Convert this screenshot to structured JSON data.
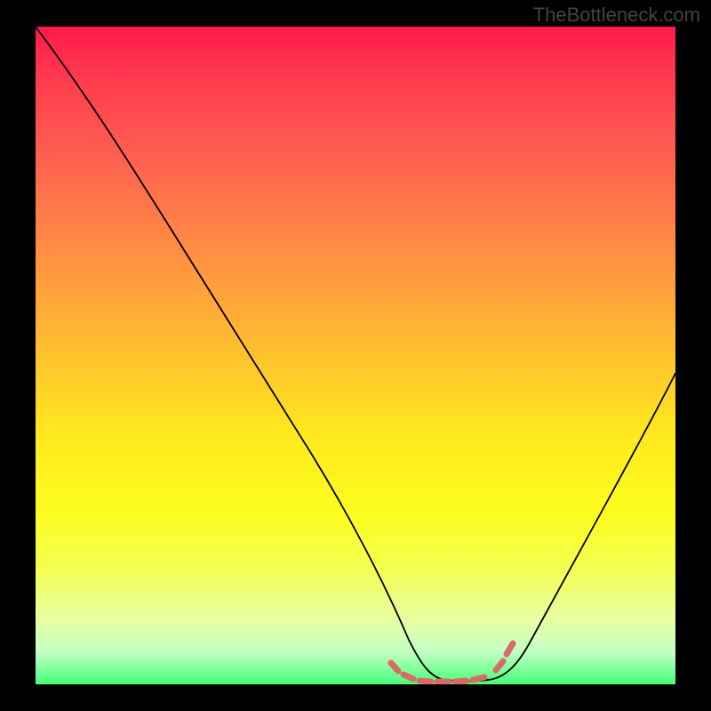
{
  "watermark": "TheBottleneck.com",
  "chart_data": {
    "type": "line",
    "title": "",
    "xlabel": "",
    "ylabel": "",
    "xlim": [
      0,
      100
    ],
    "ylim": [
      0,
      100
    ],
    "x": [
      0,
      5,
      10,
      15,
      20,
      25,
      30,
      35,
      40,
      45,
      50,
      55,
      58,
      60,
      62,
      65,
      68,
      70,
      72,
      74,
      76,
      80,
      85,
      90,
      95,
      100
    ],
    "y": [
      100,
      94,
      88,
      82,
      75,
      68,
      60,
      52,
      44,
      36,
      28,
      18,
      10,
      5,
      3,
      2,
      2,
      2,
      3,
      4,
      6,
      12,
      20,
      28,
      36,
      44
    ],
    "gradient_stops": [
      {
        "pos": 0,
        "color": "#ff1a4a"
      },
      {
        "pos": 50,
        "color": "#ffc22e"
      },
      {
        "pos": 75,
        "color": "#fdfd1e"
      },
      {
        "pos": 100,
        "color": "#46ff78"
      }
    ],
    "valley_marker": {
      "x_range": [
        56,
        76
      ],
      "color": "#e67a7a",
      "style": "dashed-thick"
    },
    "curve_color": "#000000"
  }
}
